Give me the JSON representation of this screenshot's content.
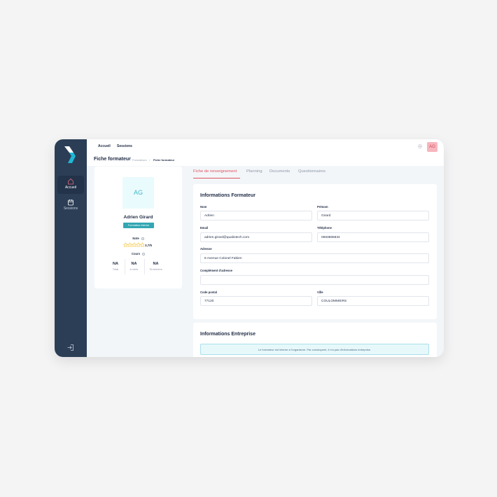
{
  "colors": {
    "sidebar": "#2c3e56",
    "accent": "#e05260",
    "teal": "#33a7b3"
  },
  "sidebar": {
    "items": [
      {
        "label": "Accueil",
        "icon": "home-icon",
        "active": true
      },
      {
        "label": "Sessions",
        "icon": "calendar-icon",
        "active": false
      }
    ],
    "logout_icon": "logout-icon"
  },
  "topbar": {
    "links": [
      "Accueil",
      "Sessions"
    ],
    "avatar_initials": "AG"
  },
  "header": {
    "title": "Fiche formateur",
    "breadcrumb": [
      "Formateurs",
      "Fiche formateur"
    ]
  },
  "profile": {
    "initials": "AG",
    "name": "Adrien Girard",
    "badge": "Formateur interne",
    "note_label": "Note",
    "rating_value": 3.7,
    "rating_max": 5,
    "rating_text": "3,7/5",
    "cours_label": "Cours",
    "courses": [
      {
        "value": "NA",
        "label": "Total"
      },
      {
        "value": "NA",
        "label": "A venir"
      },
      {
        "value": "NA",
        "label": "Terminées"
      }
    ]
  },
  "tabs": [
    "Fiche de renseignement",
    "Planning",
    "Documents",
    "Questionnaires"
  ],
  "formateur": {
    "title": "Informations Formateur",
    "nom_label": "Nom",
    "nom": "Adrien",
    "prenom_label": "Prénom",
    "prenom": "Girard",
    "email_label": "Email",
    "email": "adrien.girard@qualiotech.com",
    "tel_label": "Téléphone",
    "tel": "0693885834",
    "adresse_label": "Adresse",
    "adresse": "6 Avenue Colonel Fabien",
    "complement_label": "Complément d'adresse",
    "complement": "",
    "cp_label": "Code postal",
    "cp": "77120",
    "ville_label": "Ville",
    "ville": "COULOMMIERS"
  },
  "entreprise": {
    "title": "Informations Entreprise",
    "notice": "Le formateur est interne à l'organisme. Par conséquent, il n'a pas d'informations entreprise."
  }
}
